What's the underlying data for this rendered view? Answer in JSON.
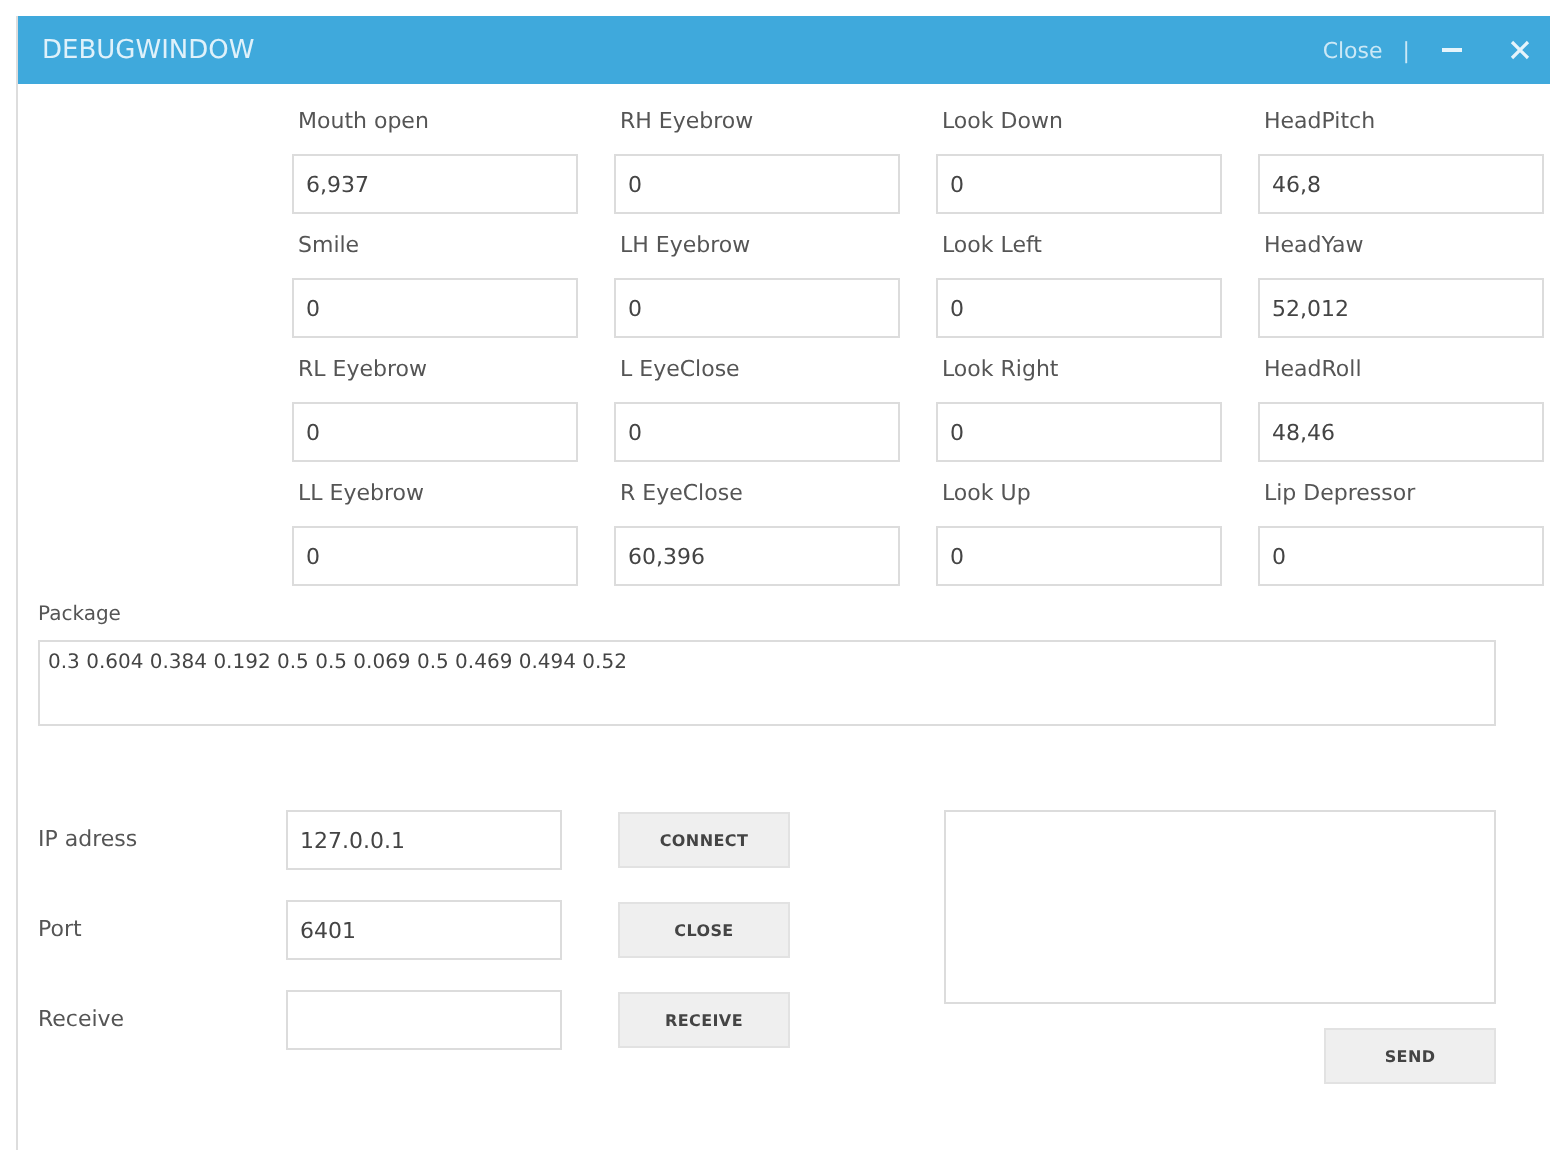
{
  "window": {
    "title": "DEBUGWINDOW",
    "title_bar_buttons": [
      {
        "kind": "text",
        "label": "Close"
      },
      {
        "kind": "divider",
        "label": "|"
      },
      {
        "kind": "minimize"
      },
      {
        "kind": "close"
      }
    ]
  },
  "parameters": [
    {
      "label": "Mouth open",
      "value": "6,937"
    },
    {
      "label": "RH Eyebrow",
      "value": "0"
    },
    {
      "label": "Look Down",
      "value": "0"
    },
    {
      "label": "HeadPitch",
      "value": "46,8"
    },
    {
      "label": "Smile",
      "value": "0"
    },
    {
      "label": "LH Eyebrow",
      "value": "0"
    },
    {
      "label": "Look Left",
      "value": "0"
    },
    {
      "label": "HeadYaw",
      "value": "52,012"
    },
    {
      "label": "RL Eyebrow",
      "value": "0"
    },
    {
      "label": "L EyeClose",
      "value": "0"
    },
    {
      "label": "Look Right",
      "value": "0"
    },
    {
      "label": "HeadRoll",
      "value": "48,46"
    },
    {
      "label": "LL Eyebrow",
      "value": "0"
    },
    {
      "label": "R EyeClose",
      "value": "60,396"
    },
    {
      "label": "Look Up",
      "value": "0"
    },
    {
      "label": "Lip Depressor",
      "value": "0"
    }
  ],
  "package": {
    "label": "Package",
    "value": "0.3 0.604 0.384 0.192 0.5 0.5 0.069 0.5 0.469 0.494 0.52"
  },
  "connection": [
    {
      "label": "IP adress",
      "value": "127.0.0.1",
      "button": "CONNECT"
    },
    {
      "label": "Port",
      "value": "6401",
      "button": "CLOSE"
    },
    {
      "label": "Receive",
      "button": "RECEIVE"
    }
  ],
  "send_button": "SEND"
}
